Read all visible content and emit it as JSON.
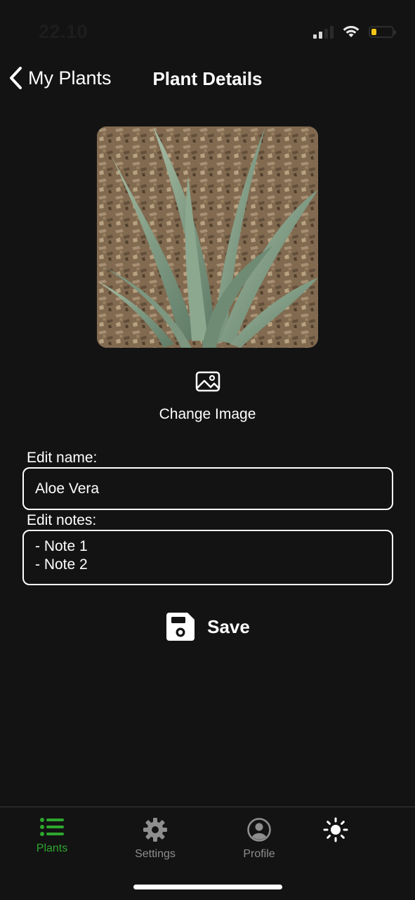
{
  "status_bar": {
    "time": "22.10",
    "battery_level": 0.25,
    "battery_color": "#f5c518"
  },
  "header": {
    "back_label": "My Plants",
    "title": "Plant Details"
  },
  "plant": {
    "change_image_label": "Change Image",
    "name_label": "Edit name:",
    "name_value": "Aloe Vera",
    "notes_label": "Edit notes:",
    "notes_value": "- Note 1\n- Note 2"
  },
  "save": {
    "label": "Save"
  },
  "tabs": [
    {
      "label": "Plants",
      "icon": "list-icon",
      "active": true
    },
    {
      "label": "Settings",
      "icon": "gear-icon",
      "active": false
    },
    {
      "label": "Profile",
      "icon": "user-circle-icon",
      "active": false
    },
    {
      "label": "",
      "icon": "sun-icon",
      "active": false
    }
  ],
  "colors": {
    "background": "#131313",
    "accent_active": "#2ea62e",
    "inactive": "#8e8e8e",
    "text": "#ffffff"
  }
}
